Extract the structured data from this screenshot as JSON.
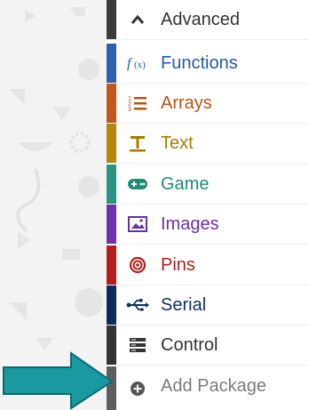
{
  "toolbox": {
    "items": [
      {
        "label": "Advanced",
        "icon": "chevron-up-icon",
        "color": "#333333",
        "bar": "#3c3c3c"
      },
      {
        "label": "Functions",
        "icon": "function-icon",
        "color": "#1f5ba8",
        "bar": "#2b62b0"
      },
      {
        "label": "Arrays",
        "icon": "numbered-list-icon",
        "color": "#b8520f",
        "bar": "#c3561a"
      },
      {
        "label": "Text",
        "icon": "text-icon",
        "color": "#a87b00",
        "bar": "#b4880a"
      },
      {
        "label": "Game",
        "icon": "gamepad-icon",
        "color": "#1e8c78",
        "bar": "#2a9480"
      },
      {
        "label": "Images",
        "icon": "image-icon",
        "color": "#6a2fa8",
        "bar": "#6e33ab"
      },
      {
        "label": "Pins",
        "icon": "target-icon",
        "color": "#b21e1e",
        "bar": "#b41e1e"
      },
      {
        "label": "Serial",
        "icon": "usb-icon",
        "color": "#0f2f66",
        "bar": "#0d2c5e"
      },
      {
        "label": "Control",
        "icon": "server-icon",
        "color": "#333333",
        "bar": "#333333"
      },
      {
        "label": "Add Package",
        "icon": "plus-circle-icon",
        "color": "#7b7b7b",
        "bar": "#5e5e5e"
      }
    ]
  },
  "colors": {
    "arrow_fill": "#1a9aa0",
    "arrow_stroke": "#0b6a70"
  }
}
